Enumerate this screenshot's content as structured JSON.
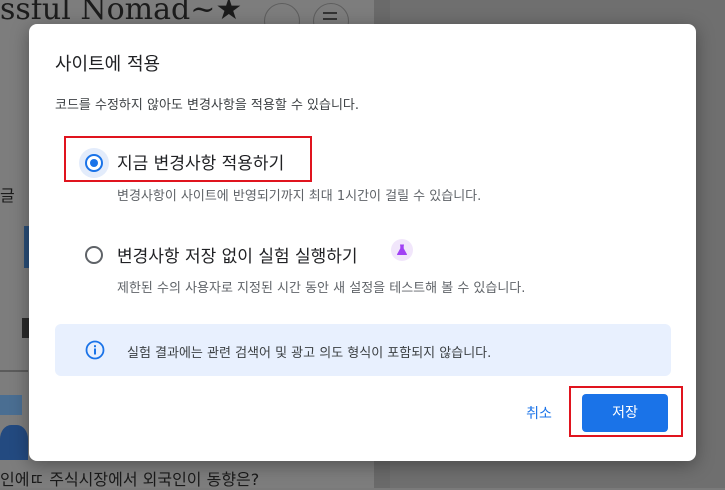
{
  "background": {
    "site_title": "ssful Nomad~★",
    "side_char": "글",
    "bottom_text": "인에ㄸ 주식시장에서 외국인이 동향은?"
  },
  "dialog": {
    "title": "사이트에 적용",
    "description": "코드를 수정하지 않아도 변경사항을 적용할 수 있습니다.",
    "options": [
      {
        "label": "지금 변경사항 적용하기",
        "sublabel": "변경사항이 사이트에 반영되기까지 최대 1시간이 걸릴 수 있습니다.",
        "selected": true
      },
      {
        "label": "변경사항 저장 없이 실험 실행하기",
        "sublabel": "제한된 수의 사용자로 지정된 시간 동안 새 설정을 테스트해 볼 수 있습니다.",
        "selected": false,
        "icon": "flask-icon"
      }
    ],
    "info": {
      "icon": "info-icon",
      "text": "실험 결과에는 관련 검색어 및 광고 의도 형식이 포함되지 않습니다."
    },
    "buttons": {
      "cancel": "취소",
      "save": "저장"
    }
  },
  "colors": {
    "accent": "#1a73e8",
    "highlight_box": "#e0141e",
    "info_bg": "#e8f0fe",
    "lab_purple": "#a142f4"
  }
}
